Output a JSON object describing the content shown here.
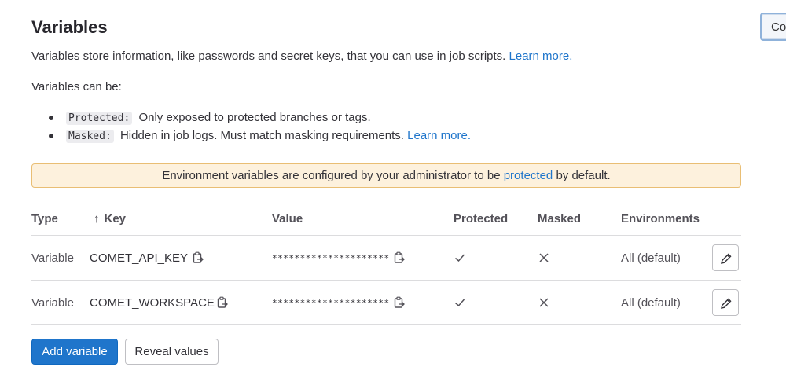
{
  "corner_button": "Co",
  "section": {
    "title": "Variables",
    "description": "Variables store information, like passwords and secret keys, that you can use in job scripts.",
    "learn_more": "Learn more.",
    "can_be": "Variables can be:",
    "bullets": [
      {
        "code": "Protected:",
        "text": "Only exposed to protected branches or tags.",
        "link": ""
      },
      {
        "code": "Masked:",
        "text": "Hidden in job logs. Must match masking requirements.",
        "link": "Learn more."
      }
    ]
  },
  "alert": {
    "before": "Environment variables are configured by your administrator to be",
    "link": "protected",
    "after": "by default.",
    "bg_color": "#fdf1dd",
    "border_color": "#e9be74"
  },
  "table": {
    "headers": {
      "type": "Type",
      "key_arrow": "↑",
      "key": "Key",
      "value": "Value",
      "protected": "Protected",
      "masked": "Masked",
      "environments": "Environments"
    },
    "rows": [
      {
        "type": "Variable",
        "key": "COMET_API_KEY",
        "value": "*********************",
        "protected": true,
        "masked": false,
        "environment": "All (default)"
      },
      {
        "type": "Variable",
        "key": "COMET_WORKSPACE",
        "value": "*********************",
        "protected": true,
        "masked": false,
        "environment": "All (default)"
      }
    ],
    "icons": {
      "copy": "copy-to-clipboard-icon",
      "check": "check-icon",
      "cross": "close-icon",
      "edit": "pencil-icon"
    }
  },
  "actions": {
    "add_variable": "Add variable",
    "reveal_values": "Reveal values",
    "primary_color": "#1f75cb"
  }
}
